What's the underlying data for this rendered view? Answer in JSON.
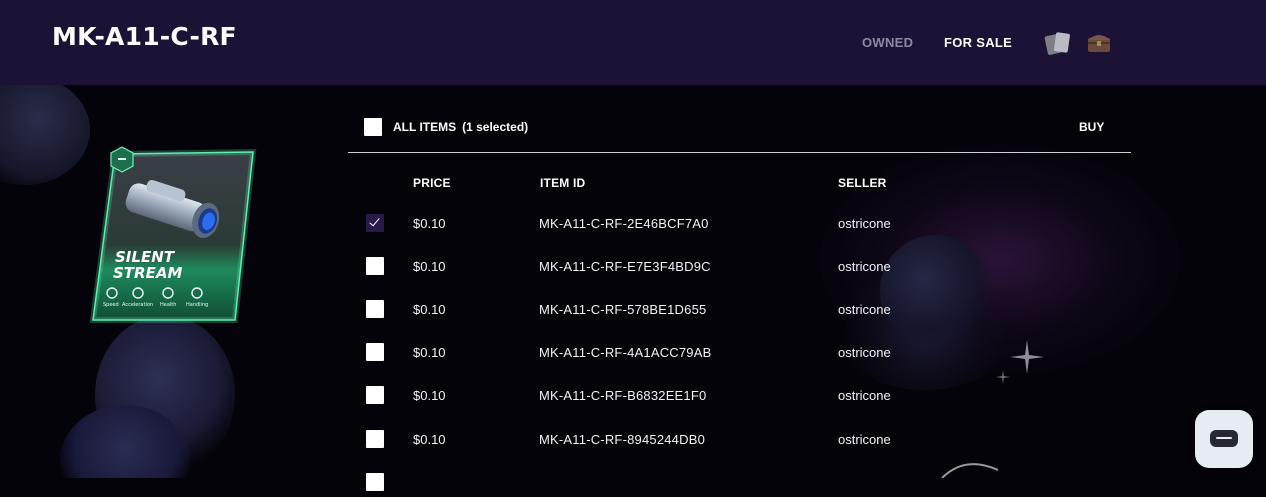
{
  "header": {
    "title": "MK-A11-C-RF",
    "tabs": [
      {
        "label": "OWNED",
        "active": false
      },
      {
        "label": "FOR SALE",
        "active": true
      }
    ],
    "icons": [
      "cards-icon",
      "treasure-chest-icon"
    ]
  },
  "item_card": {
    "name_line1": "SILENT",
    "name_line2": "STREAM",
    "badge": "–",
    "stats": [
      "Speed",
      "Acceleration",
      "Health",
      "Handling"
    ]
  },
  "listing": {
    "select_all_label": "ALL ITEMS",
    "selected_count_text": "(1 selected)",
    "buy_label": "BUY",
    "columns": {
      "price": "PRICE",
      "item_id": "ITEM ID",
      "seller": "SELLER"
    },
    "rows": [
      {
        "checked": true,
        "price": "$0.10",
        "item_id": "MK-A11-C-RF-2E46BCF7A0",
        "seller": "ostricone"
      },
      {
        "checked": false,
        "price": "$0.10",
        "item_id": "MK-A11-C-RF-E7E3F4BD9C",
        "seller": "ostricone"
      },
      {
        "checked": false,
        "price": "$0.10",
        "item_id": "MK-A11-C-RF-578BE1D655",
        "seller": "ostricone"
      },
      {
        "checked": false,
        "price": "$0.10",
        "item_id": "MK-A11-C-RF-4A1ACC79AB",
        "seller": "ostricone"
      },
      {
        "checked": false,
        "price": "$0.10",
        "item_id": "MK-A11-C-RF-B6832EE1F0",
        "seller": "ostricone"
      },
      {
        "checked": false,
        "price": "$0.10",
        "item_id": "MK-A11-C-RF-8945244DB0",
        "seller": "ostricone"
      }
    ]
  },
  "colors": {
    "header_bg": "#1c1236",
    "page_bg": "#05030a",
    "checkbox_checked": "#271a49",
    "card_accent": "#2fd08a"
  }
}
